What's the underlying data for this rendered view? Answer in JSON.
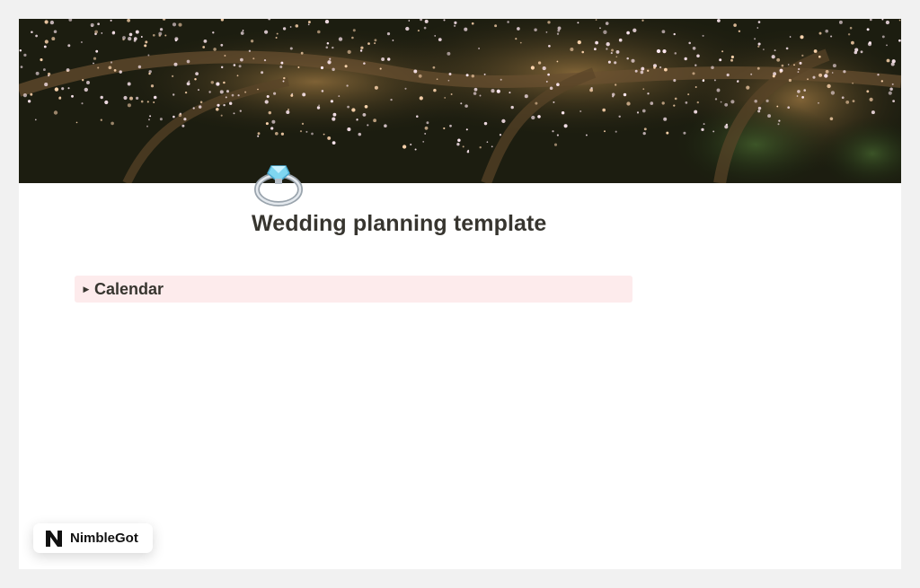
{
  "page": {
    "title": "Wedding planning template",
    "icon": "ring-icon",
    "cover": "night-trees-with-string-lights"
  },
  "blocks": [
    {
      "type": "toggle",
      "label": "Calendar",
      "expanded": false,
      "background": "#fdebec"
    }
  ],
  "badge": {
    "logo": "N",
    "text": "NimbleGot"
  },
  "colors": {
    "text": "#37352f",
    "toggle_bg": "#fdebec",
    "outer_bg": "#f1f1f1"
  }
}
